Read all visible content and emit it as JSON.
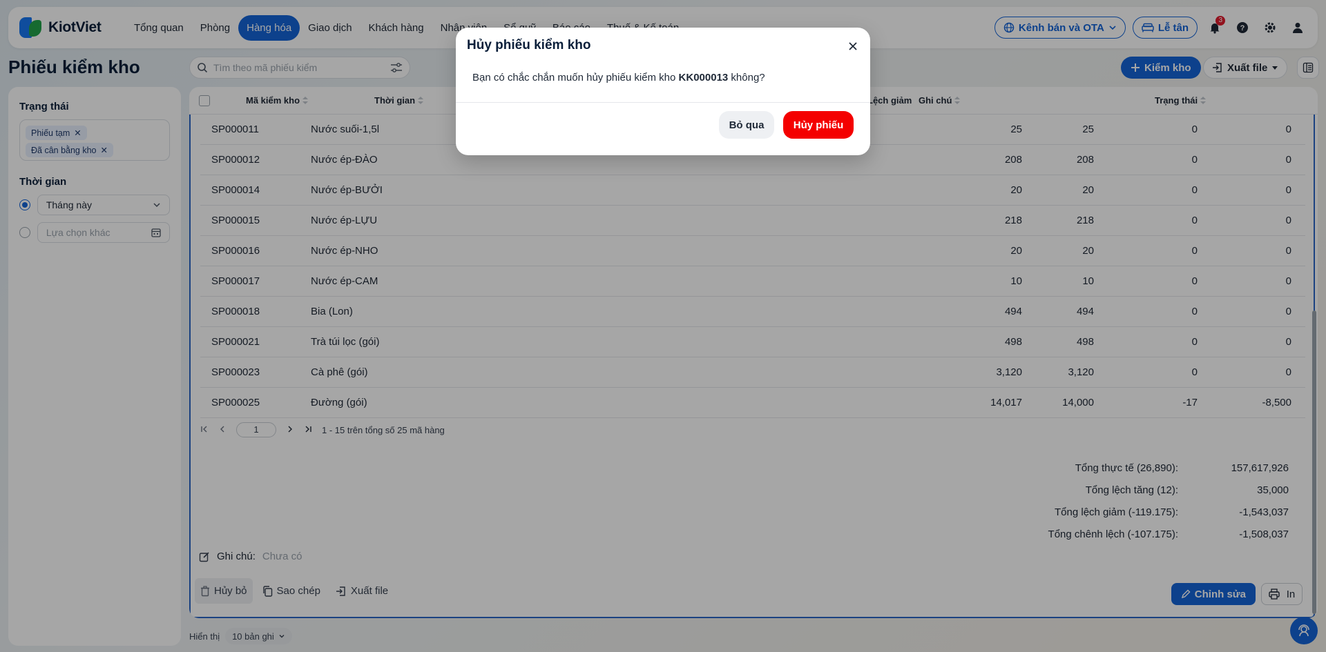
{
  "app": {
    "brand": "KiotViet",
    "nav": [
      "Tổng quan",
      "Phòng",
      "Hàng hóa",
      "Giao dịch",
      "Khách hàng",
      "Nhân viên",
      "Sổ quỹ",
      "Báo cáo",
      "Thuế & Kế toán"
    ],
    "active_nav": "Hàng hóa",
    "channel_btn": "Kênh bán và OTA",
    "reception_btn": "Lễ tân",
    "notification_count": "3"
  },
  "page": {
    "title": "Phiếu kiểm kho",
    "search_placeholder": "Tìm theo mã phiếu kiểm",
    "add_btn": "Kiểm kho",
    "export_btn": "Xuất file"
  },
  "filters": {
    "status_label": "Trạng thái",
    "status_tags": [
      "Phiếu tạm",
      "Đã cân bằng kho"
    ],
    "time_label": "Thời gian",
    "time_option_selected": "Tháng này",
    "time_option_other": "Lựa chọn khác"
  },
  "table": {
    "headers": {
      "code": "Mã kiểm kho",
      "time": "Thời gian",
      "decrease": "Lệch giảm",
      "note": "Ghi chú",
      "status": "Trạng thái"
    },
    "rows": [
      {
        "code": "SP000011",
        "name": "Nước suối-1,5l",
        "a": "25",
        "b": "25",
        "c": "0",
        "d": "0"
      },
      {
        "code": "SP000012",
        "name": "Nước ép-ĐÀO",
        "a": "208",
        "b": "208",
        "c": "0",
        "d": "0"
      },
      {
        "code": "SP000014",
        "name": "Nước ép-BƯỞI",
        "a": "20",
        "b": "20",
        "c": "0",
        "d": "0"
      },
      {
        "code": "SP000015",
        "name": "Nước ép-LỰU",
        "a": "218",
        "b": "218",
        "c": "0",
        "d": "0"
      },
      {
        "code": "SP000016",
        "name": "Nước ép-NHO",
        "a": "20",
        "b": "20",
        "c": "0",
        "d": "0"
      },
      {
        "code": "SP000017",
        "name": "Nước ép-CAM",
        "a": "10",
        "b": "10",
        "c": "0",
        "d": "0"
      },
      {
        "code": "SP000018",
        "name": "Bia (Lon)",
        "a": "494",
        "b": "494",
        "c": "0",
        "d": "0"
      },
      {
        "code": "SP000021",
        "name": "Trà túi lọc (gói)",
        "a": "498",
        "b": "498",
        "c": "0",
        "d": "0"
      },
      {
        "code": "SP000023",
        "name": "Cà phê (gói)",
        "a": "3,120",
        "b": "3,120",
        "c": "0",
        "d": "0"
      },
      {
        "code": "SP000025",
        "name": "Đường (gói)",
        "a": "14,017",
        "b": "14,000",
        "c": "-17",
        "d": "-8,500"
      }
    ],
    "pager": {
      "page": "1",
      "summary": "1 - 15 trên tổng số 25 mã hàng"
    },
    "totals": [
      {
        "label": "Tổng thực tế (26,890):",
        "value": "157,617,926"
      },
      {
        "label": "Tổng lệch tăng (12):",
        "value": "35,000"
      },
      {
        "label": "Tổng lệch giảm (-119.175):",
        "value": "-1,543,037"
      },
      {
        "label": "Tổng chênh lệch (-107.175):",
        "value": "-1,508,037"
      }
    ],
    "note_label": "Ghi chú:",
    "note_value": "Chưa có",
    "actions": {
      "cancel": "Hủy bỏ",
      "copy": "Sao chép",
      "export": "Xuất file",
      "edit": "Chỉnh sửa",
      "print": "In"
    }
  },
  "footer": {
    "show_label": "Hiển thị",
    "page_size": "10 bản ghi"
  },
  "modal": {
    "title": "Hủy phiếu kiểm kho",
    "message_prefix": "Bạn có chắc chắn muốn hủy phiếu kiểm kho",
    "message_code": "KK000013",
    "message_suffix": "không?",
    "skip_btn": "Bỏ qua",
    "confirm_btn": "Hủy phiếu"
  },
  "colors": {
    "primary": "#1565d8",
    "danger": "#f40000"
  }
}
